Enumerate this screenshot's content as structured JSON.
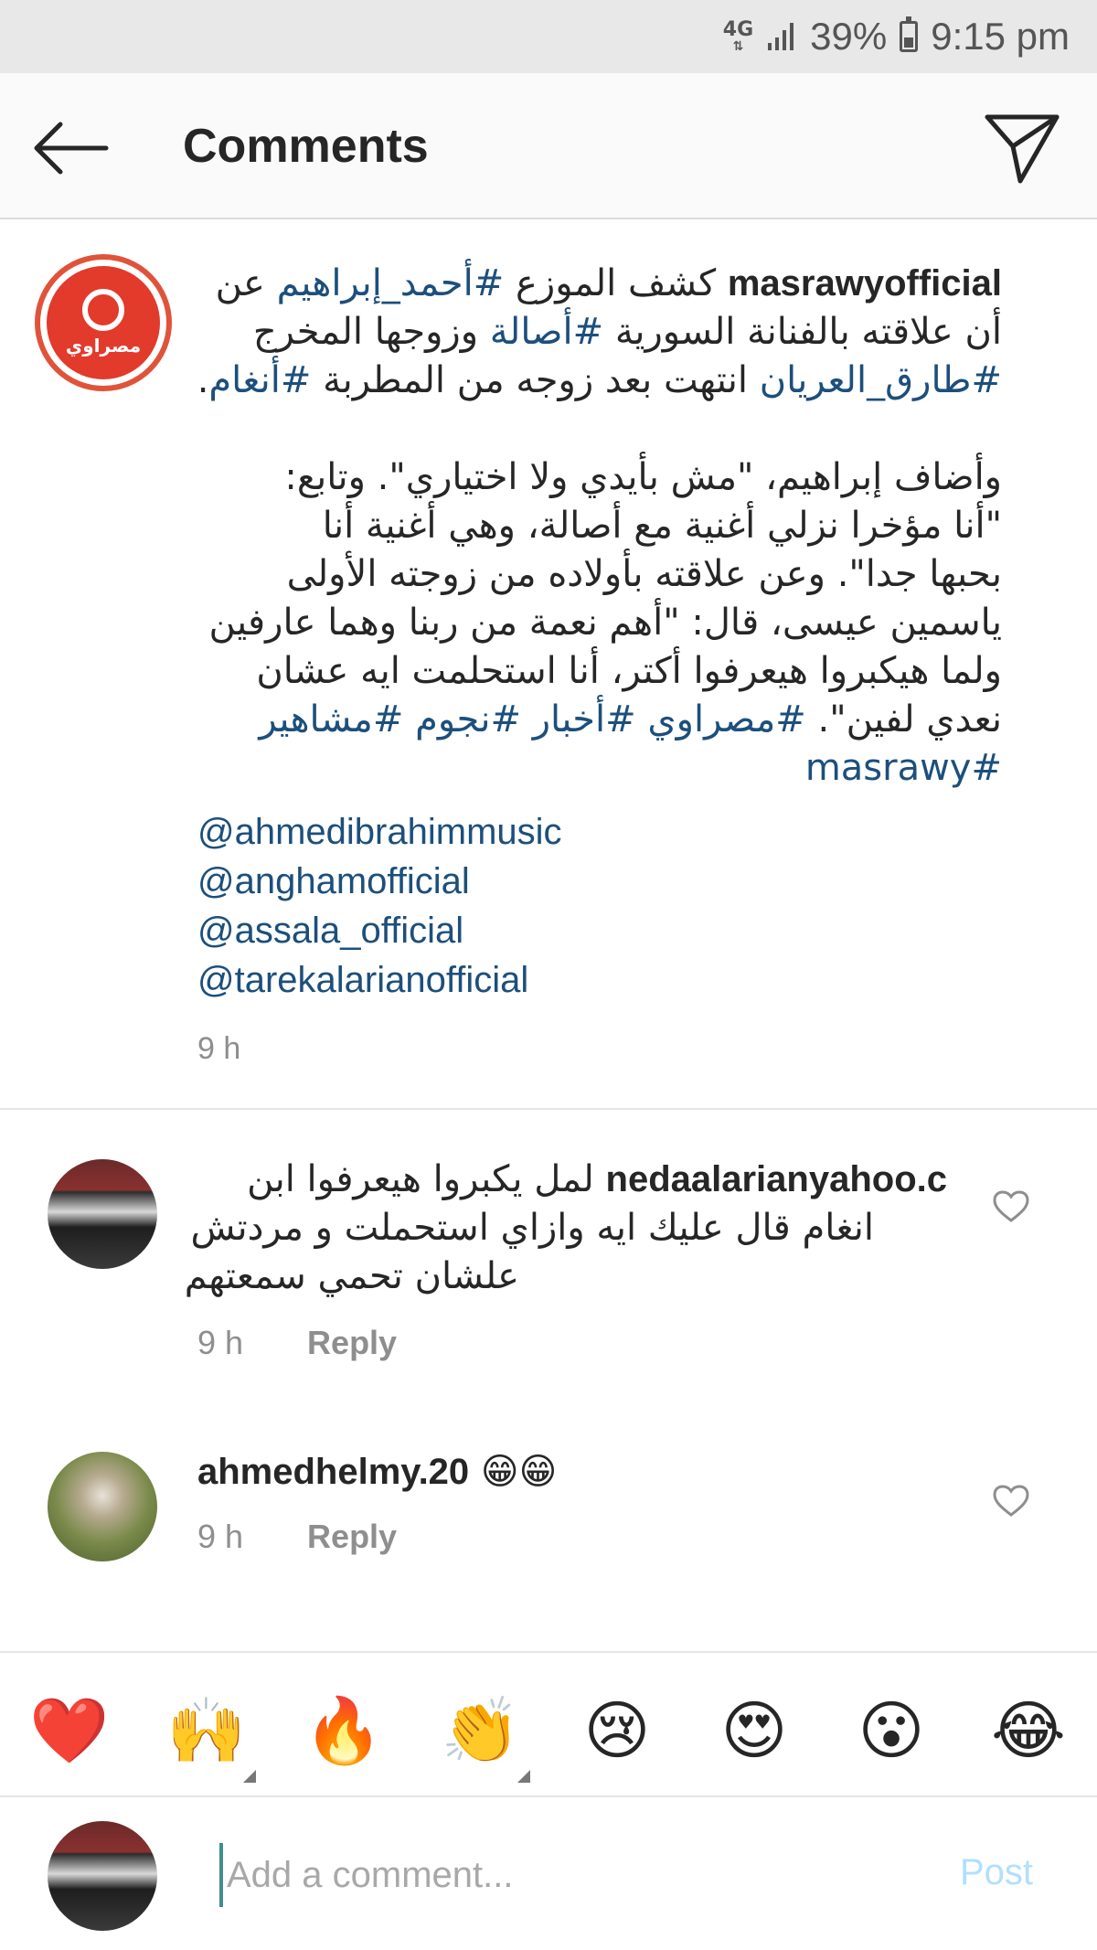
{
  "status_bar": {
    "network": "4G",
    "battery": "39%",
    "battery_level": 0.39,
    "time": "9:15 pm"
  },
  "header": {
    "title": "Comments",
    "back_icon": "arrow-left-icon",
    "share_icon": "paper-plane-icon"
  },
  "caption": {
    "username": "masrawyofficial",
    "avatar_word": "مصراوي",
    "lines": [
      [
        {
          "text": "كشف الموزع ",
          "tag": false
        },
        {
          "text": "#أحمد_إبراهيم",
          "tag": true
        },
        {
          "text": " عن",
          "tag": false
        }
      ],
      [
        {
          "text": "أن علاقته بالفنانة السورية ",
          "tag": false
        },
        {
          "text": "#أصالة",
          "tag": true
        },
        {
          "text": " وزوجها المخرج",
          "tag": false
        }
      ],
      [
        {
          "text": "#طارق_العريان",
          "tag": true
        },
        {
          "text": " انتهت بعد زوجه من المطربة ",
          "tag": false
        },
        {
          "text": "#أنغام",
          "tag": true
        },
        {
          "text": ".",
          "tag": false
        }
      ]
    ],
    "body_lines": [
      "وأضاف إبراهيم، \"مش بأيدي ولا اختياري\". وتابع:",
      "\"أنا مؤخرا نزلي أغنية مع أصالة، وهي أغنية أنا",
      "بحبها جدا\". وعن علاقته بأولاده من زوجته الأولى",
      "ياسمين عيسى، قال: \"أهم نعمة من ربنا وهما عارفين",
      "ولما هيكبروا هيعرفوا أكتر، أنا استحلمت ايه عشان"
    ],
    "tag_line_prefix": "نعدي لفين\". ",
    "tag_line_tags": "#مصراوي #أخبار #نجوم #مشاهير",
    "last_tag": "masrawy#",
    "mentions": [
      "@ahmedibrahimmusic",
      "@anghamofficial",
      "@assala_official",
      "@tarekalarianofficial"
    ],
    "time": "9 h"
  },
  "comments": [
    {
      "username": "nedaalarianyahoo.c",
      "text_line1": "لمل يكبروا هيعرفوا ابن",
      "text_line2": "انغام قال عليك ايه وازاي استحملت و مردتش",
      "text_line3": "علشان تحمي سمعتهم",
      "time": "9 h",
      "reply": "Reply",
      "like_icon": "heart-outline-icon"
    },
    {
      "username": "ahmedhelmy.20",
      "emoji": "😁😁",
      "time": "9 h",
      "reply": "Reply",
      "like_icon": "heart-outline-icon"
    }
  ],
  "emoji_bar": [
    {
      "emoji": "❤️",
      "name": "red-heart"
    },
    {
      "emoji": "🙌",
      "name": "raising-hands"
    },
    {
      "emoji": "🔥",
      "name": "fire"
    },
    {
      "emoji": "👏",
      "name": "clapping-hands"
    },
    {
      "emoji": "😢",
      "name": "crying-face"
    },
    {
      "emoji": "😍",
      "name": "heart-eyes"
    },
    {
      "emoji": "😮",
      "name": "open-mouth"
    },
    {
      "emoji": "😂",
      "name": "tears-of-joy"
    }
  ],
  "input": {
    "placeholder": "Add a comment...",
    "post": "Post"
  },
  "colors": {
    "link": "#1c4f7c",
    "muted": "#8e8e8e",
    "post_disabled": "#b2dffc",
    "brand_red": "#e23a2b"
  }
}
